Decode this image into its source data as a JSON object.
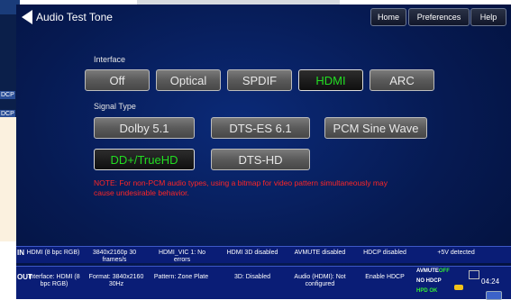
{
  "background_window": {
    "labels": [
      "DCP",
      "DCP"
    ]
  },
  "header": {
    "title": "Audio Test Tone",
    "nav": [
      "Home",
      "Preferences",
      "Help"
    ]
  },
  "interface": {
    "label": "Interface",
    "options": [
      "Off",
      "Optical",
      "SPDIF",
      "HDMI",
      "ARC"
    ],
    "selected": "HDMI"
  },
  "signal_type": {
    "label": "Signal Type",
    "options": [
      "Dolby 5.1",
      "DTS-ES 6.1",
      "PCM Sine Wave",
      "DD+/TrueHD",
      "DTS-HD"
    ],
    "selected": "DD+/TrueHD"
  },
  "note": "NOTE: For non-PCM audio types, using a bitmap for video pattern simultaneously may cause undesirable behavior.",
  "status_row1": {
    "side": "IN",
    "cells": [
      "HDMI (8 bpc RGB)",
      "3840x2160p 30 frames/s",
      "HDMI_VIC 1: No errors",
      "HDMI 3D disabled",
      "AVMUTE disabled",
      "HDCP disabled",
      "+5V detected"
    ]
  },
  "status_row2": {
    "side": "OUT",
    "cells": [
      "Interface: HDMI (8 bpc RGB)",
      "Format: 3840x2160 30Hz",
      "Pattern: Zone Plate",
      "3D: Disabled",
      "Audio (HDMI): Not configured",
      "Enable HDCP"
    ],
    "avmute": "AVMUTE",
    "avmute_state": "OFF",
    "no_hdcp": "NO HDCP",
    "hpd": "HPD OK",
    "clock": "04:24"
  },
  "colors": {
    "selected_text": "#22dd22",
    "note_text": "#ff2626",
    "status_bg": "#0a1d76"
  }
}
